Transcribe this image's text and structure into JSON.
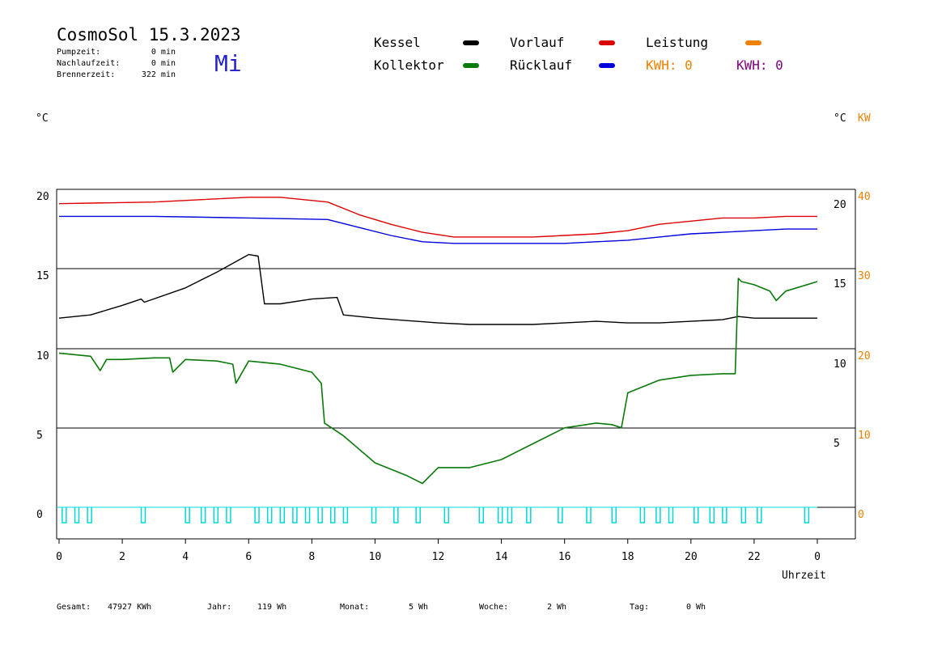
{
  "header": {
    "title": "CosmoSol 15.3.2023",
    "day": "Mi",
    "pump_label": "Pumpzeit:",
    "pump_value": "0 min",
    "after_label": "Nachlaufzeit:",
    "after_value": "0 min",
    "burner_label": "Brennerzeit:",
    "burner_value": "322 min"
  },
  "legend": {
    "kessel": "Kessel",
    "kollektor": "Kollektor",
    "vorlauf": "Vorlauf",
    "ruecklauf": "Rücklauf",
    "leistung": "Leistung",
    "kwh1": "KWH: 0",
    "kwh2": "KWH: 0"
  },
  "colors": {
    "kessel": "#000000",
    "kollektor": "#0a7a0a",
    "vorlauf": "#dd0000",
    "ruecklauf": "#0000dd",
    "leistung": "#f08000",
    "kwh2": "#800080",
    "pump": "#00d8d8",
    "day": "#2222cc"
  },
  "axes": {
    "left_unit": "°C",
    "right_unit": "°C",
    "right_unit2": "KW",
    "xlabel": "Uhrzeit"
  },
  "footer": {
    "gesamt_label": "Gesamt:",
    "gesamt_value": "47927 KWh",
    "jahr_label": "Jahr:",
    "jahr_value": "119 Wh",
    "monat_label": "Monat:",
    "monat_value": "5 Wh",
    "woche_label": "Woche:",
    "woche_value": "2 Wh",
    "tag_label": "Tag:",
    "tag_value": "0 Wh"
  },
  "chart_data": {
    "type": "line",
    "x_unit": "hour",
    "xlim": [
      0,
      24
    ],
    "ylim": [
      0,
      20
    ],
    "x_ticks": [
      "0",
      "2",
      "4",
      "6",
      "8",
      "10",
      "12",
      "14",
      "16",
      "18",
      "20",
      "22",
      "0"
    ],
    "y_left_ticks": [
      "0",
      "5",
      "10",
      "15",
      "20"
    ],
    "y_right_ticks": [
      "5",
      "10",
      "15",
      "20"
    ],
    "y_right_kw_ticks": [
      "0",
      "10",
      "20",
      "30",
      "40"
    ],
    "grid": true,
    "series": [
      {
        "name": "Vorlauf",
        "color_key": "vorlauf",
        "x": [
          0,
          3,
          6,
          7,
          8.5,
          9.5,
          10.5,
          11.5,
          12.5,
          14,
          15,
          16,
          17,
          18,
          19,
          20,
          21,
          22,
          23,
          24
        ],
        "y": [
          19.1,
          19.2,
          19.5,
          19.5,
          19.2,
          18.4,
          17.8,
          17.3,
          17.0,
          17.0,
          17.0,
          17.1,
          17.2,
          17.4,
          17.8,
          18.0,
          18.2,
          18.2,
          18.3,
          18.3
        ]
      },
      {
        "name": "Rücklauf",
        "color_key": "ruecklauf",
        "x": [
          0,
          3,
          6,
          8.5,
          9.5,
          10.5,
          11.5,
          12.5,
          14,
          15,
          16,
          17,
          18,
          19,
          20,
          21,
          22,
          23,
          24
        ],
        "y": [
          18.3,
          18.3,
          18.2,
          18.1,
          17.6,
          17.1,
          16.7,
          16.6,
          16.6,
          16.6,
          16.6,
          16.7,
          16.8,
          17.0,
          17.2,
          17.3,
          17.4,
          17.5,
          17.5
        ]
      },
      {
        "name": "Kessel",
        "color_key": "kessel",
        "x": [
          0,
          1,
          2,
          2.6,
          2.7,
          4,
          5,
          6,
          6.3,
          6.5,
          7,
          8,
          8.8,
          9,
          9.5,
          10,
          12,
          13,
          14,
          15,
          16,
          17,
          18,
          19,
          20,
          21,
          21.5,
          22,
          23,
          24
        ],
        "y": [
          11.9,
          12.1,
          12.7,
          13.1,
          12.9,
          13.8,
          14.8,
          15.9,
          15.8,
          12.8,
          12.8,
          13.1,
          13.2,
          12.1,
          12.0,
          11.9,
          11.6,
          11.5,
          11.5,
          11.5,
          11.6,
          11.7,
          11.6,
          11.6,
          11.7,
          11.8,
          12.0,
          11.9,
          11.9,
          11.9
        ]
      },
      {
        "name": "Kollektor",
        "color_key": "kollektor",
        "x": [
          0,
          1,
          1.3,
          1.5,
          2,
          3,
          3.5,
          3.6,
          4,
          5,
          5.5,
          5.6,
          6,
          7,
          8,
          8.3,
          8.4,
          9,
          10,
          11,
          11.5,
          12,
          12.5,
          13,
          14,
          15,
          16,
          17,
          17.5,
          17.8,
          18,
          19,
          20,
          21,
          21.4,
          21.5,
          21.6,
          22,
          22.5,
          22.7,
          23,
          24
        ],
        "y": [
          9.7,
          9.5,
          8.6,
          9.3,
          9.3,
          9.4,
          9.4,
          8.5,
          9.3,
          9.2,
          9.0,
          7.8,
          9.2,
          9.0,
          8.5,
          7.8,
          5.3,
          4.5,
          2.8,
          2.0,
          1.5,
          2.5,
          2.5,
          2.5,
          3.0,
          4.0,
          5.0,
          5.3,
          5.2,
          5.0,
          7.2,
          8.0,
          8.3,
          8.4,
          8.4,
          14.4,
          14.2,
          14.0,
          13.6,
          13.0,
          13.6,
          14.2
        ]
      }
    ],
    "pump_pulses_hours": [
      0.1,
      0.5,
      0.9,
      2.6,
      4.0,
      4.5,
      4.9,
      5.3,
      6.2,
      6.6,
      7.0,
      7.4,
      7.8,
      8.2,
      8.6,
      9.0,
      9.9,
      10.6,
      11.3,
      12.2,
      13.3,
      13.9,
      14.2,
      14.8,
      15.8,
      16.7,
      17.5,
      18.4,
      18.9,
      19.3,
      20.1,
      20.6,
      21.0,
      21.6,
      22.1,
      23.6
    ]
  }
}
